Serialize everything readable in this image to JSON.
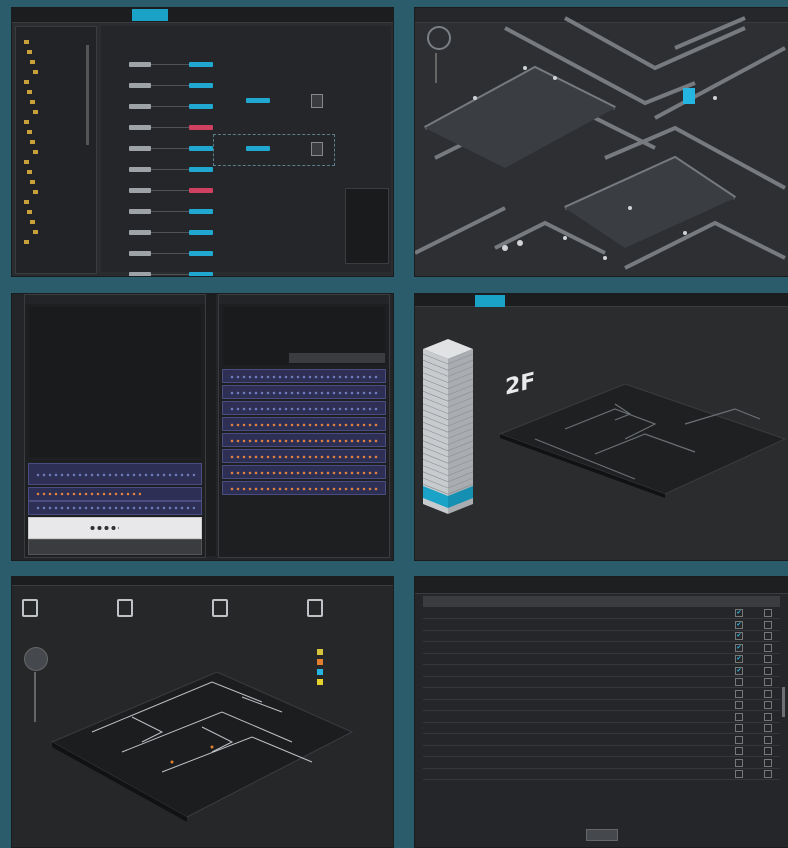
{
  "panel1": {
    "tabs": [
      "",
      "",
      "",
      "",
      ""
    ],
    "active_tab_index": 4,
    "tree_items": [
      "",
      "",
      "",
      "",
      "",
      "",
      "",
      "",
      "",
      "",
      "",
      "",
      "",
      "",
      "",
      "",
      "",
      "",
      "",
      "",
      ""
    ],
    "status_left": "",
    "status_right": ""
  },
  "panel2": {
    "top_labels": [
      "",
      "",
      "",
      "",
      ""
    ]
  },
  "panel3": {
    "rack_left_title": "",
    "rack_right_title": ""
  },
  "panel4": {
    "floor_label": "2F",
    "tabs": [
      "",
      "",
      ""
    ],
    "active_tab_index": 2
  },
  "panel5": {
    "cards": [
      {
        "icon": "device-icon",
        "value": ""
      },
      {
        "icon": "person-icon",
        "value": ""
      },
      {
        "icon": "lock-icon",
        "value": ""
      },
      {
        "icon": "door-icon",
        "value": ""
      }
    ],
    "legend": [
      {
        "color": "#d7c23b",
        "text": ""
      },
      {
        "color": "#e0802f",
        "text": ""
      },
      {
        "color": "#25b5e2",
        "text": ""
      },
      {
        "color": "#e6d22a",
        "text": ""
      }
    ]
  },
  "panel6": {
    "title": "",
    "headers": [
      "",
      "",
      "",
      "",
      ""
    ],
    "rows": [
      {
        "code": "",
        "desc": "",
        "type": "",
        "c1": true,
        "c2": false
      },
      {
        "code": "",
        "desc": "",
        "type": "",
        "c1": true,
        "c2": false
      },
      {
        "code": "",
        "desc": "",
        "type": "",
        "c1": true,
        "c2": false
      },
      {
        "code": "",
        "desc": "",
        "type": "",
        "c1": true,
        "c2": false
      },
      {
        "code": "",
        "desc": "",
        "type": "",
        "c1": true,
        "c2": false
      },
      {
        "code": "",
        "desc": "",
        "type": "",
        "c1": true,
        "c2": false
      },
      {
        "code": "",
        "desc": "",
        "type": "",
        "c1": false,
        "c2": false
      },
      {
        "code": "",
        "desc": "",
        "type": "",
        "c1": false,
        "c2": false
      },
      {
        "code": "",
        "desc": "",
        "type": "",
        "c1": false,
        "c2": false
      },
      {
        "code": "",
        "desc": "",
        "type": "",
        "c1": false,
        "c2": false
      },
      {
        "code": "",
        "desc": "",
        "type": "",
        "c1": false,
        "c2": false
      },
      {
        "code": "",
        "desc": "",
        "type": "",
        "c1": false,
        "c2": false
      },
      {
        "code": "",
        "desc": "",
        "type": "",
        "c1": false,
        "c2": false
      },
      {
        "code": "",
        "desc": "",
        "type": "",
        "c1": false,
        "c2": false
      },
      {
        "code": "",
        "desc": "",
        "type": "",
        "c1": false,
        "c2": false
      }
    ],
    "button_label": ""
  },
  "colors": {
    "background": "#2b5c6b",
    "accent": "#1aa3c7",
    "panel": "#2a2c2f",
    "check": "#2fb8e6"
  }
}
